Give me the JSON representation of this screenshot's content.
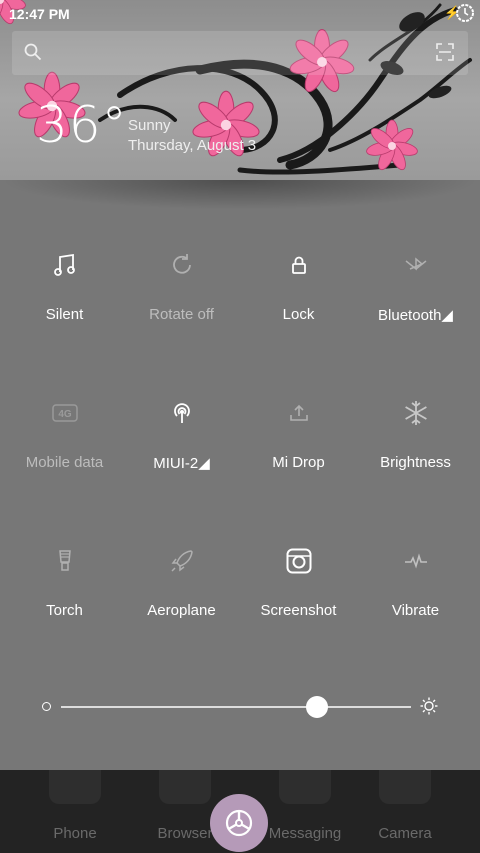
{
  "status_bar": {
    "time": "12:47 PM",
    "icons": [
      "charging-bolt-icon",
      "battery-icon"
    ]
  },
  "search": {
    "icon": "search-icon",
    "scan_icon": "scan-icon"
  },
  "weather": {
    "temperature": "36°",
    "condition": "Sunny",
    "date": "Thursday, August 3"
  },
  "toggles": [
    {
      "label": "Silent",
      "icon": "music-note-icon",
      "state": "on"
    },
    {
      "label": "Rotate off",
      "icon": "rotate-icon",
      "state": "off"
    },
    {
      "label": "Lock",
      "icon": "lock-icon",
      "state": "on"
    },
    {
      "label": "Bluetooth◢",
      "icon": "bluetooth-icon",
      "state": "off"
    },
    {
      "label": "Mobile data",
      "icon": "4g-icon",
      "state": "off"
    },
    {
      "label": "MIUI-2◢",
      "icon": "wifi-icon",
      "state": "on"
    },
    {
      "label": "Mi Drop",
      "icon": "upload-icon",
      "state": "off"
    },
    {
      "label": "Brightness",
      "icon": "snowflake-icon",
      "state": "off"
    },
    {
      "label": "Torch",
      "icon": "torch-bulb-icon",
      "state": "off"
    },
    {
      "label": "Aeroplane",
      "icon": "rocket-icon",
      "state": "off"
    },
    {
      "label": "Screenshot",
      "icon": "screenshot-camera-icon",
      "state": "on"
    },
    {
      "label": "Vibrate",
      "icon": "vibrate-wave-icon",
      "state": "off"
    }
  ],
  "brightness": {
    "level": 0.73,
    "min_icon": "dim-icon",
    "max_icon": "sun-icon"
  },
  "dock": [
    {
      "label": "Phone"
    },
    {
      "label": "Browser"
    },
    {
      "label": "Messaging"
    },
    {
      "label": "Camera"
    }
  ],
  "fab": {
    "icon": "settings-wheel-icon"
  },
  "colors": {
    "accent_pink": "#f0679c",
    "fab": "#b59ab8",
    "panel": "#777777"
  }
}
